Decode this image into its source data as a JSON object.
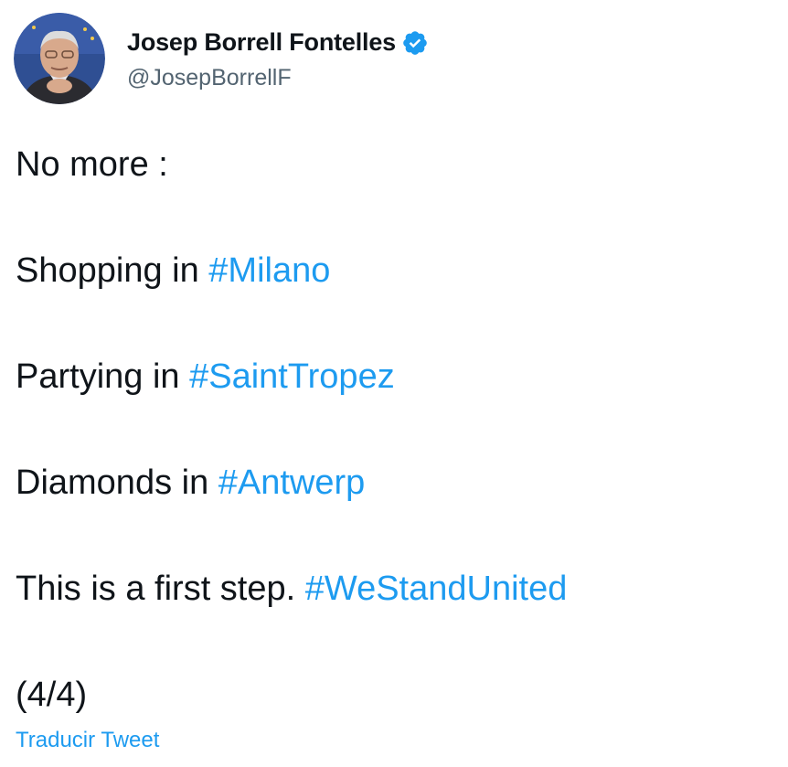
{
  "author": {
    "display_name": "Josep Borrell Fontelles",
    "handle": "@JosepBorrellF",
    "verified": true,
    "verified_icon": "verified-badge-icon"
  },
  "tweet": {
    "lines": [
      {
        "text": "No more :",
        "hashtag": ""
      },
      {
        "text": "Shopping in ",
        "hashtag": "#Milano"
      },
      {
        "text": "Partying in ",
        "hashtag": "#SaintTropez"
      },
      {
        "text": "Diamonds in ",
        "hashtag": "#Antwerp"
      },
      {
        "text": "This is a first step. ",
        "hashtag": "#WeStandUnited"
      },
      {
        "text": "(4/4)",
        "hashtag": ""
      }
    ]
  },
  "translate_label": "Traducir Tweet",
  "colors": {
    "text": "#0f1419",
    "secondary": "#536471",
    "link": "#1d9bf0",
    "verified": "#1d9bf0"
  }
}
